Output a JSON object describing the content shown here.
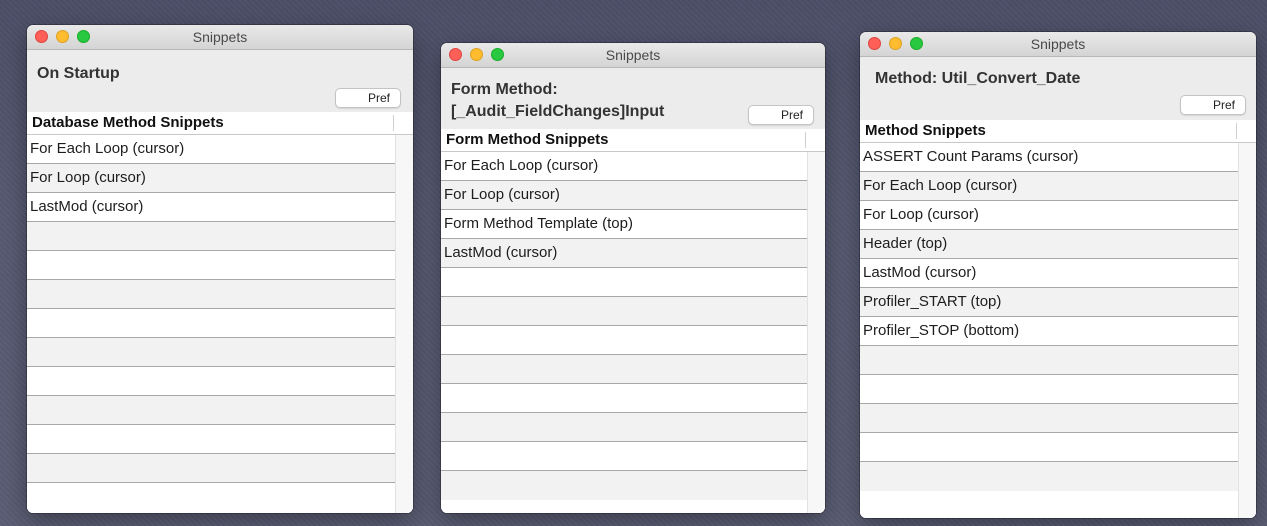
{
  "windows": [
    {
      "title": "Snippets",
      "heading": "On Startup",
      "pref_label": "Pref",
      "column_header": "Database Method Snippets",
      "items": [
        "For Each Loop (cursor)",
        "For Loop (cursor)",
        "LastMod (cursor)"
      ]
    },
    {
      "title": "Snippets",
      "heading_line1": "Form Method:",
      "heading_line2": "[_Audit_FieldChanges]Input",
      "pref_label": "Pref",
      "column_header": "Form Method Snippets",
      "items": [
        "For Each Loop (cursor)",
        "For Loop (cursor)",
        "Form Method Template (top)",
        "LastMod (cursor)"
      ]
    },
    {
      "title": "Snippets",
      "heading": "Method: Util_Convert_Date",
      "pref_label": "Pref",
      "column_header": "Method Snippets",
      "items": [
        "ASSERT Count Params (cursor)",
        "For Each Loop (cursor)",
        "For Loop (cursor)",
        "Header (top)",
        "LastMod (cursor)",
        "Profiler_START (top)",
        "Profiler_STOP (bottom)"
      ]
    }
  ]
}
